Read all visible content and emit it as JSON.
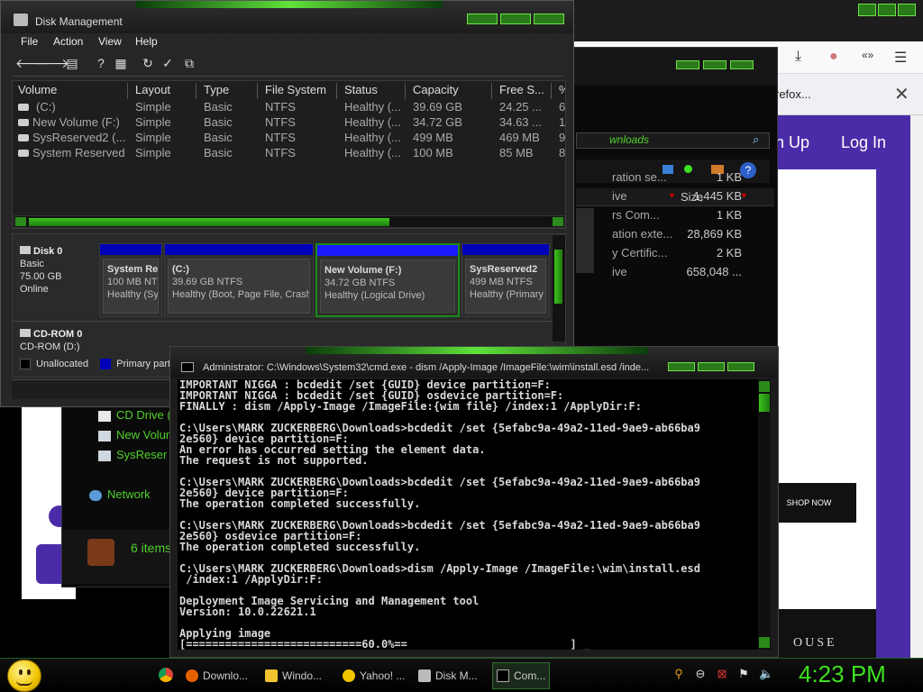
{
  "browser": {
    "tab_text": "refox...",
    "nav_signup": "n Up",
    "nav_login": "Log In",
    "shop_now": "SHOP NOW",
    "brand_tail": "OUSE"
  },
  "explorer": {
    "address_text": "wnloads",
    "size_header": "Size",
    "files": [
      {
        "name": "ration se...",
        "size": "1 KB"
      },
      {
        "name": "ive",
        "size": "1,445 KB"
      },
      {
        "name": "rs Com...",
        "size": "1 KB"
      },
      {
        "name": "ation exte...",
        "size": "28,869 KB"
      },
      {
        "name": "y Certific...",
        "size": "2 KB"
      },
      {
        "name": "ive",
        "size": "658,048 ..."
      }
    ],
    "nav_items": [
      {
        "label": "CD Drive ("
      },
      {
        "label": "New Volun"
      },
      {
        "label": "SysReser"
      },
      {
        "label": "Network"
      }
    ],
    "item_count": "6 items"
  },
  "disk_management": {
    "title": "Disk Management",
    "menu": [
      "File",
      "Action",
      "View",
      "Help"
    ],
    "columns": [
      "Volume",
      "Layout",
      "Type",
      "File System",
      "Status",
      "Capacity",
      "Free S...",
      "%"
    ],
    "volumes": [
      {
        "volume": "(C:)",
        "layout": "Simple",
        "type": "Basic",
        "fs": "NTFS",
        "status": "Healthy (...",
        "capacity": "39.69 GB",
        "free": "24.25 ...",
        "pct": "6"
      },
      {
        "volume": "New Volume (F:)",
        "layout": "Simple",
        "type": "Basic",
        "fs": "NTFS",
        "status": "Healthy (...",
        "capacity": "34.72 GB",
        "free": "34.63 ...",
        "pct": "1"
      },
      {
        "volume": "SysReserved2 (...",
        "layout": "Simple",
        "type": "Basic",
        "fs": "NTFS",
        "status": "Healthy (...",
        "capacity": "499 MB",
        "free": "469 MB",
        "pct": "9"
      },
      {
        "volume": "System Reserved",
        "layout": "Simple",
        "type": "Basic",
        "fs": "NTFS",
        "status": "Healthy (...",
        "capacity": "100 MB",
        "free": "85 MB",
        "pct": "8"
      }
    ],
    "disk0": {
      "name": "Disk 0",
      "type": "Basic",
      "size": "75.00 GB",
      "state": "Online"
    },
    "partitions": [
      {
        "title": "System Re",
        "size": "100 MB NTF",
        "status": "Healthy (Sy"
      },
      {
        "title": "(C:)",
        "size": "39.69 GB NTFS",
        "status": "Healthy (Boot, Page File, Crash"
      },
      {
        "title": "New Volume  (F:)",
        "size": "34.72 GB NTFS",
        "status": "Healthy (Logical Drive)"
      },
      {
        "title": "SysReserved2",
        "size": "499 MB NTFS",
        "status": "Healthy (Primary"
      }
    ],
    "cdrom": {
      "name": "CD-ROM 0",
      "drive": "CD-ROM (D:)"
    },
    "legend": {
      "unallocated": "Unallocated",
      "primary": "Primary partitio"
    },
    "colors": {
      "unallocated": "#000000",
      "primary": "#0000b8"
    }
  },
  "cmd": {
    "title": "Administrator: C:\\Windows\\System32\\cmd.exe - dism  /Apply-Image /ImageFile:\\wim\\install.esd /inde...",
    "lines": [
      "IMPORTANT NIGGA : bcdedit /set {GUID} device partition=F:",
      "IMPORTANT NIGGA : bcdedit /set {GUID} osdevice partition=F:",
      "FINALLY : dism /Apply-Image /ImageFile:{wim file} /index:1 /ApplyDir:F:",
      "",
      "C:\\Users\\MARK ZUCKERBERG\\Downloads>bcdedit /set {5efabc9a-49a2-11ed-9ae9-ab66ba9",
      "2e560} device partition=F:",
      "An error has occurred setting the element data.",
      "The request is not supported.",
      "",
      "C:\\Users\\MARK ZUCKERBERG\\Downloads>bcdedit /set {5efabc9a-49a2-11ed-9ae9-ab66ba9",
      "2e560} device partition=F:",
      "The operation completed successfully.",
      "",
      "C:\\Users\\MARK ZUCKERBERG\\Downloads>bcdedit /set {5efabc9a-49a2-11ed-9ae9-ab66ba9",
      "2e560} osdevice partition=F:",
      "The operation completed successfully.",
      "",
      "C:\\Users\\MARK ZUCKERBERG\\Downloads>dism /Apply-Image /ImageFile:\\wim\\install.esd",
      " /index:1 /ApplyDir:F:",
      "",
      "Deployment Image Servicing and Management tool",
      "Version: 10.0.22621.1",
      "",
      "Applying image",
      "[===========================60.0%==                         ] _"
    ]
  },
  "taskbar": {
    "items": [
      {
        "label": "Downlo...",
        "icon": "firefox-icon"
      },
      {
        "label": "Windo...",
        "icon": "explorer-icon"
      },
      {
        "label": "Yahoo! ...",
        "icon": "yahoo-icon"
      },
      {
        "label": "Disk M...",
        "icon": "disk-icon"
      },
      {
        "label": "Com...",
        "icon": "cmd-icon"
      }
    ],
    "clock": "4:23 PM"
  }
}
